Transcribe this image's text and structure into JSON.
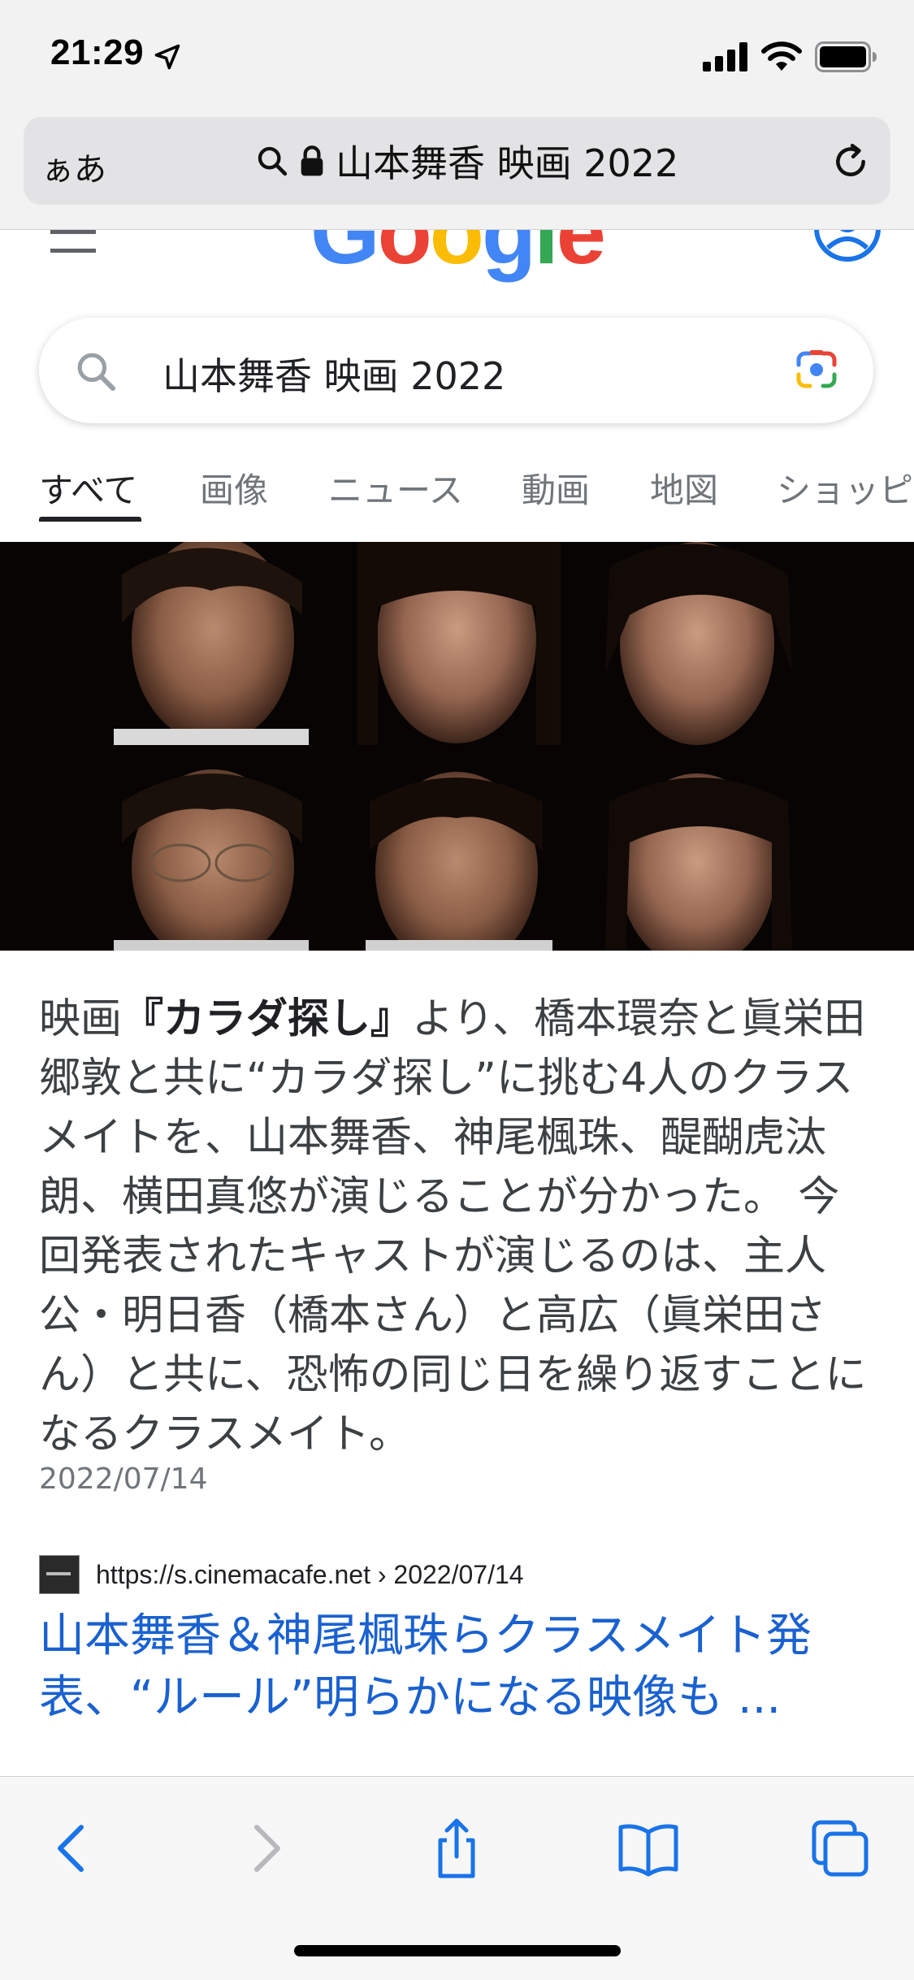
{
  "status_bar": {
    "time": "21:29"
  },
  "address_bar": {
    "aa_label": "ぁあ",
    "url_text": "山本舞香 映画 2022"
  },
  "google": {
    "logo_letters": [
      "G",
      "o",
      "o",
      "g",
      "l",
      "e"
    ],
    "logo_colors": [
      "#4285F4",
      "#EA4335",
      "#FBBC05",
      "#4285F4",
      "#34A853",
      "#EA4335"
    ]
  },
  "search": {
    "query": "山本舞香 映画 2022"
  },
  "tabs": [
    {
      "label": "すべて",
      "active": true
    },
    {
      "label": "画像"
    },
    {
      "label": "ニュース"
    },
    {
      "label": "動画"
    },
    {
      "label": "地図"
    },
    {
      "label": "ショッピ"
    }
  ],
  "snippet": {
    "prefix": "映画",
    "bold": "『カラダ探し』",
    "body": "より、橋本環奈と眞栄田郷敦と共に“カラダ探し”に挑む4人のクラスメイトを、山本舞香、神尾楓珠、醍醐虎汰朗、横田真悠が演じることが分かった。 今回発表されたキャストが演じるのは、主人公・明日香（橋本さん）と高広（眞栄田さん）と共に、恐怖の同じ日を繰り返すことになるクラスメイト。",
    "date": "2022/07/14"
  },
  "result": {
    "source": "https://s.cinemacafe.net › 2022/07/14",
    "title": "山本舞香＆神尾楓珠らクラスメイト発表、“ルール”明らかになる映像も ..."
  },
  "colors": {
    "link": "#1a61d0",
    "toolbar_blue": "#1a73e8",
    "toolbar_disabled": "#b9b9bd"
  }
}
